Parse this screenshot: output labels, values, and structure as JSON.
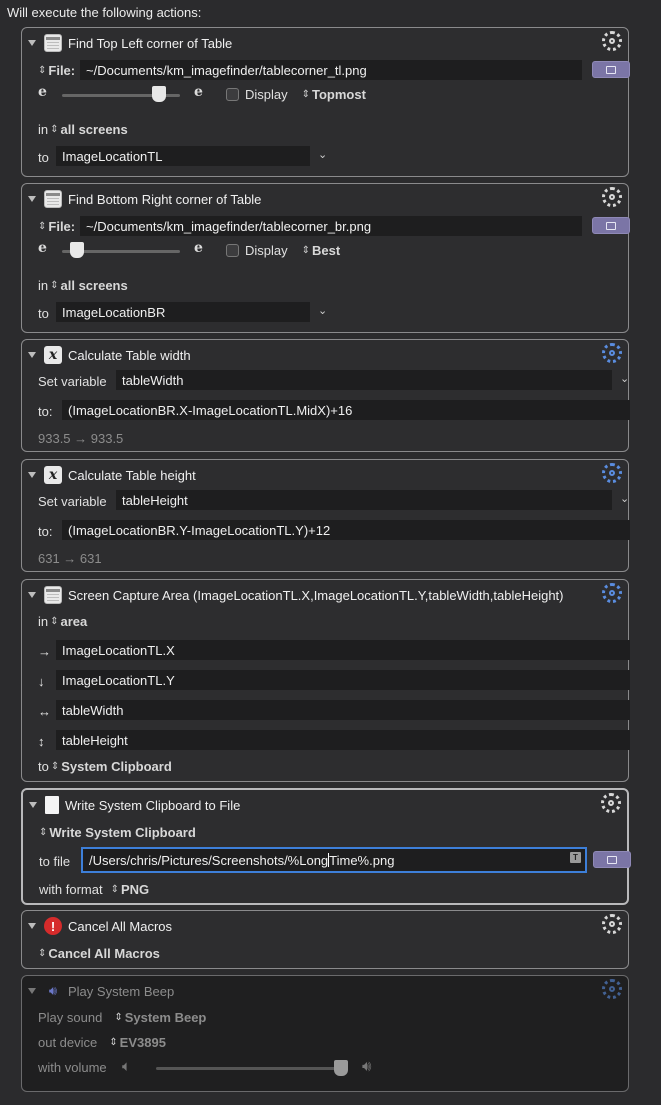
{
  "header": "Will execute the following actions:",
  "a1": {
    "title": "Find Top Left corner of Table",
    "file_label": "File:",
    "file_value": "~/Documents/km_imagefinder/tablecorner_tl.png",
    "display_label": "Display",
    "match_mode": "Topmost",
    "in_label": "in",
    "in_value": "all screens",
    "to_label": "to",
    "to_value": "ImageLocationTL",
    "fuzz_left": "e",
    "fuzz_right": "e"
  },
  "a2": {
    "title": "Find Bottom Right corner of Table",
    "file_label": "File:",
    "file_value": "~/Documents/km_imagefinder/tablecorner_br.png",
    "display_label": "Display",
    "match_mode": "Best",
    "in_label": "in",
    "in_value": "all screens",
    "to_label": "to",
    "to_value": "ImageLocationBR",
    "fuzz_left": "e",
    "fuzz_right": "e"
  },
  "a3": {
    "title": "Calculate Table width",
    "setvar_label": "Set variable",
    "setvar_value": "tableWidth",
    "to_label": "to:",
    "to_value": "(ImageLocationBR.X-ImageLocationTL.MidX)+16",
    "result": "933.5 → 933.5"
  },
  "a4": {
    "title": "Calculate Table height",
    "setvar_label": "Set variable",
    "setvar_value": "tableHeight",
    "to_label": "to:",
    "to_value": "(ImageLocationBR.Y-ImageLocationTL.Y)+12",
    "result": "631 → 631"
  },
  "a5": {
    "title": "Screen Capture Area (ImageLocationTL.X,ImageLocationTL.Y,tableWidth,tableHeight)",
    "in_label": "in",
    "in_value": "area",
    "left_value": "ImageLocationTL.X",
    "top_value": "ImageLocationTL.Y",
    "width_value": "tableWidth",
    "height_value": "tableHeight",
    "to_label": "to",
    "to_value": "System Clipboard",
    "arrow_left": "→",
    "arrow_top": "↓",
    "arrow_width": "↔",
    "arrow_height": "↕"
  },
  "a6": {
    "title": "Write System Clipboard to File",
    "source_value": "Write System Clipboard",
    "tofile_label": "to file",
    "tofile_value_a": "/Users/chris/Pictures/Screenshots/%Long",
    "tofile_value_b": "Time%.png",
    "format_label": "with format",
    "format_value": "PNG",
    "badge": "T"
  },
  "a7": {
    "title": "Cancel All Macros",
    "value": "Cancel All Macros"
  },
  "a8": {
    "title": "Play System Beep",
    "sound_label": "Play sound",
    "sound_value": "System Beep",
    "device_label": "out device",
    "device_value": "EV3895",
    "volume_label": "with volume"
  }
}
